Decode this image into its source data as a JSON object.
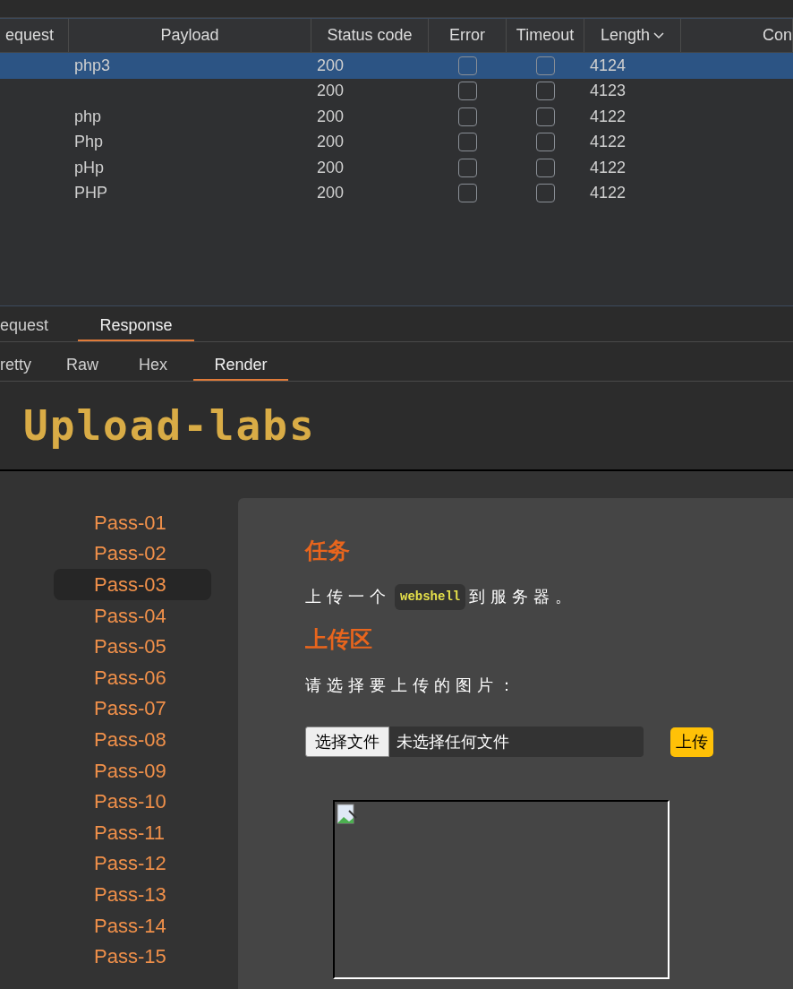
{
  "table": {
    "columns": [
      {
        "label": "equest"
      },
      {
        "label": "Payload"
      },
      {
        "label": "Status code"
      },
      {
        "label": "Error"
      },
      {
        "label": "Timeout"
      },
      {
        "label": "Length",
        "sorted": true
      },
      {
        "label": "Con"
      }
    ],
    "rows": [
      {
        "payload": "php3",
        "status": "200",
        "error": false,
        "timeout": false,
        "length": "4124",
        "selected": true
      },
      {
        "payload": "",
        "status": "200",
        "error": false,
        "timeout": false,
        "length": "4123",
        "selected": false
      },
      {
        "payload": "php",
        "status": "200",
        "error": false,
        "timeout": false,
        "length": "4122",
        "selected": false
      },
      {
        "payload": "Php",
        "status": "200",
        "error": false,
        "timeout": false,
        "length": "4122",
        "selected": false
      },
      {
        "payload": "pHp",
        "status": "200",
        "error": false,
        "timeout": false,
        "length": "4122",
        "selected": false
      },
      {
        "payload": "PHP",
        "status": "200",
        "error": false,
        "timeout": false,
        "length": "4122",
        "selected": false
      }
    ]
  },
  "message_tabs": [
    {
      "label": "equest",
      "selected": false
    },
    {
      "label": "Response",
      "selected": true
    }
  ],
  "view_tabs": [
    {
      "label": "retty",
      "selected": false
    },
    {
      "label": "Raw",
      "selected": false
    },
    {
      "label": "Hex",
      "selected": false
    },
    {
      "label": "Render",
      "selected": true
    }
  ],
  "render": {
    "logo": "Upload-labs",
    "sidebar": [
      {
        "label": "Pass-01",
        "selected": false
      },
      {
        "label": "Pass-02",
        "selected": false
      },
      {
        "label": "Pass-03",
        "selected": true
      },
      {
        "label": "Pass-04",
        "selected": false
      },
      {
        "label": "Pass-05",
        "selected": false
      },
      {
        "label": "Pass-06",
        "selected": false
      },
      {
        "label": "Pass-07",
        "selected": false
      },
      {
        "label": "Pass-08",
        "selected": false
      },
      {
        "label": "Pass-09",
        "selected": false
      },
      {
        "label": "Pass-10",
        "selected": false
      },
      {
        "label": "Pass-11",
        "selected": false
      },
      {
        "label": "Pass-12",
        "selected": false
      },
      {
        "label": "Pass-13",
        "selected": false
      },
      {
        "label": "Pass-14",
        "selected": false
      },
      {
        "label": "Pass-15",
        "selected": false
      }
    ],
    "task_heading": "任务",
    "task_text": {
      "before": "上传一个",
      "code": "webshell",
      "after": "到服务器。"
    },
    "upload_heading": "上传区",
    "upload_prompt": "请选择要上传的图片：",
    "file_button": "选择文件",
    "file_status": "未选择任何文件",
    "upload_button": "上传"
  }
}
